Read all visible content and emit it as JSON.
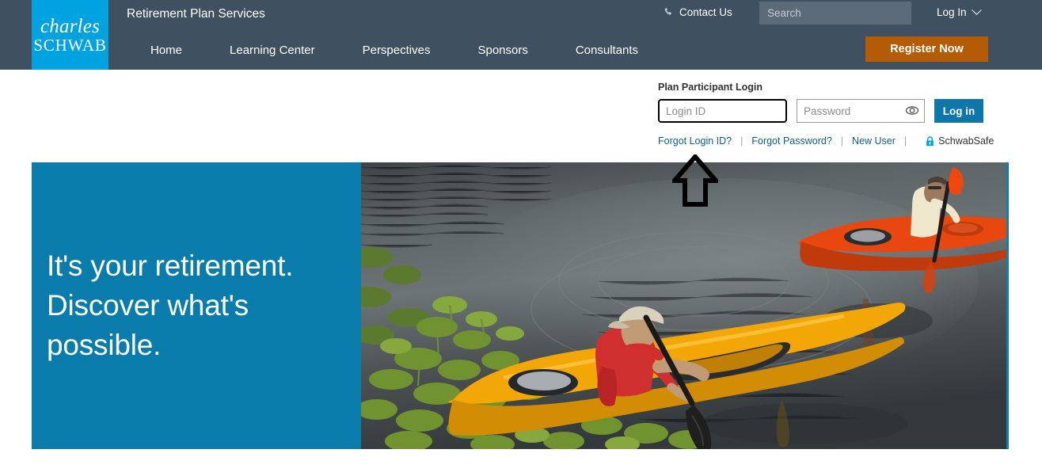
{
  "header": {
    "logo": {
      "line1": "charles",
      "line2": "SCHWAB",
      "bg_color": "#00a3e0"
    },
    "site_title": "Retirement Plan Services",
    "bg_color": "#3f5161",
    "nav": [
      {
        "label": "Home"
      },
      {
        "label": "Learning Center"
      },
      {
        "label": "Perspectives"
      },
      {
        "label": "Sponsors"
      },
      {
        "label": "Consultants"
      }
    ],
    "contact_us": {
      "label": "Contact Us",
      "icon": "phone-icon"
    },
    "search": {
      "placeholder": "Search",
      "value": ""
    },
    "log_in_menu": {
      "label": "Log In",
      "icon": "chevron-down-icon"
    },
    "register_button": {
      "label": "Register Now",
      "color": "#b35c05"
    }
  },
  "login_panel": {
    "heading": "Plan Participant Login",
    "login_id": {
      "placeholder": "Login ID",
      "value": "",
      "focused": true
    },
    "password": {
      "placeholder": "Password",
      "value": "",
      "reveal_icon": "eye-icon"
    },
    "submit_button": {
      "label": "Log in",
      "color": "#0e76a8"
    },
    "links": [
      {
        "label": "Forgot Login ID?"
      },
      {
        "label": "Forgot Password?"
      },
      {
        "label": "New User"
      }
    ],
    "separator": "|",
    "schwabsafe": {
      "label": "SchwabSafe",
      "icon": "lock-icon",
      "icon_color": "#00a3e0"
    }
  },
  "hero": {
    "panel_color": "#0a7cab",
    "headline_line1": "It's your retirement.",
    "headline_line2": "Discover what's",
    "headline_line3": "possible.",
    "photo_alt": "Two kayakers paddling on a calm lake with lily pads"
  },
  "annotation": {
    "arrow": {
      "direction": "up",
      "target": "Forgot Login ID?",
      "color": "#000000"
    }
  }
}
